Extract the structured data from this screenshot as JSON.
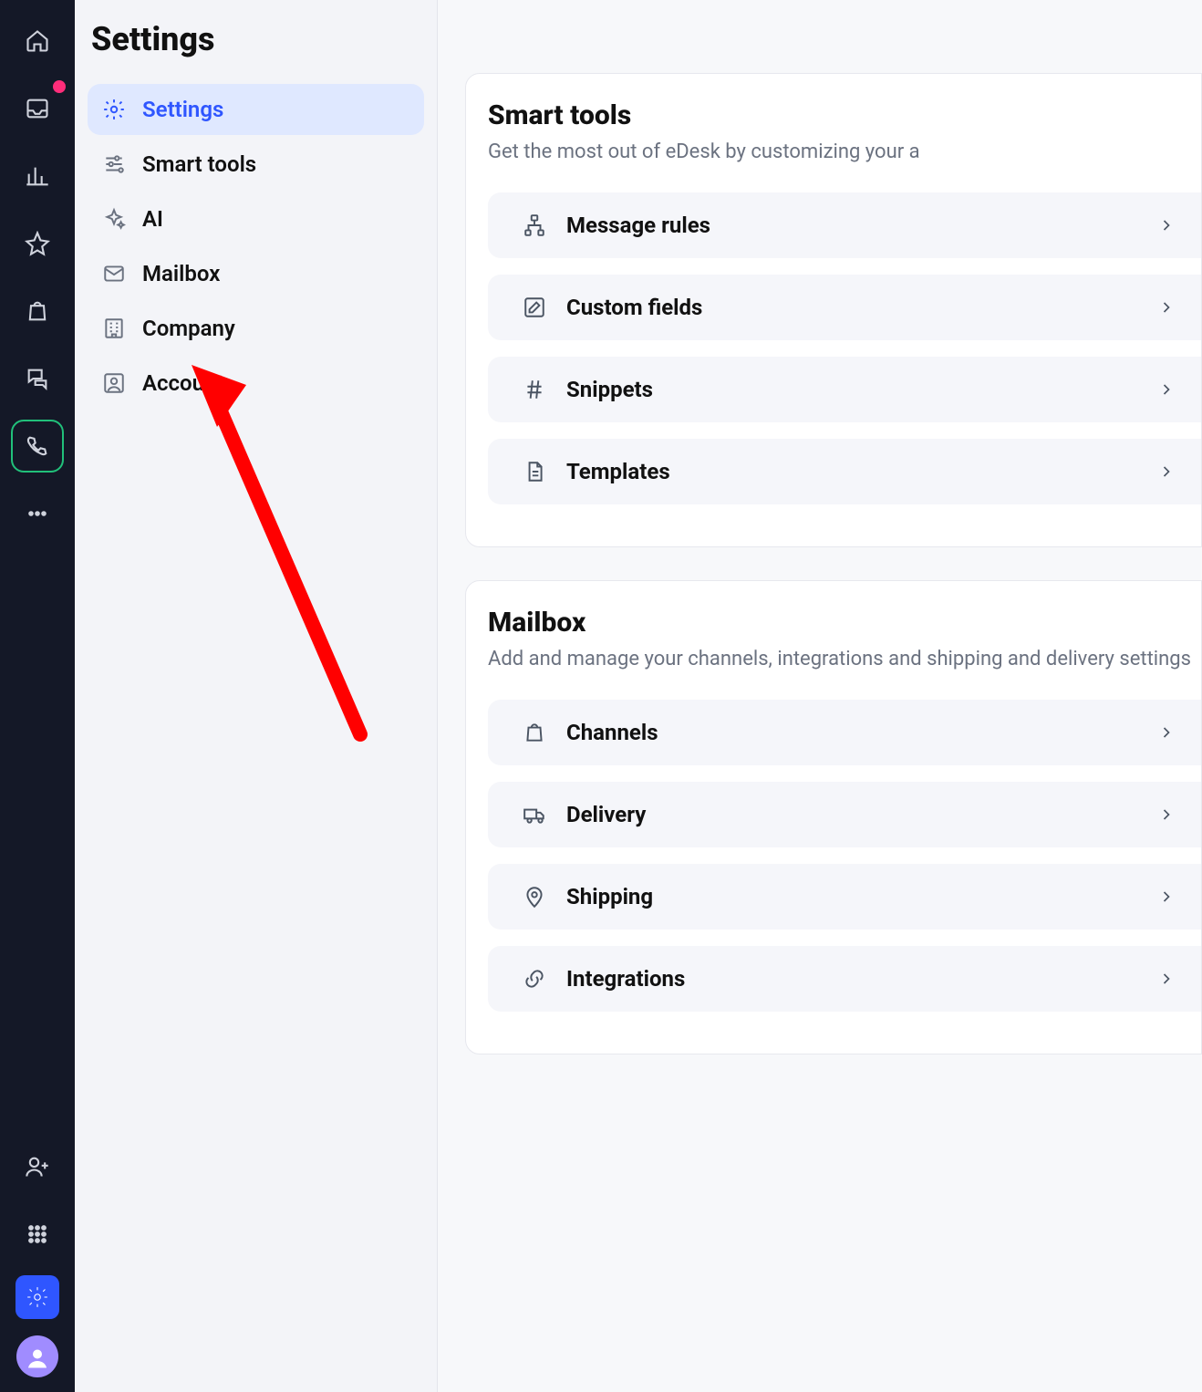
{
  "page_title": "Settings",
  "sidebar": {
    "items": [
      {
        "label": "Settings",
        "active": true
      },
      {
        "label": "Smart tools"
      },
      {
        "label": "AI"
      },
      {
        "label": "Mailbox"
      },
      {
        "label": "Company"
      },
      {
        "label": "Account"
      }
    ]
  },
  "sections": [
    {
      "title": "Smart tools",
      "subtitle": "Get the most out of eDesk by customizing your a",
      "rows": [
        {
          "label": "Message rules"
        },
        {
          "label": "Custom fields"
        },
        {
          "label": "Snippets"
        },
        {
          "label": "Templates"
        }
      ]
    },
    {
      "title": "Mailbox",
      "subtitle": "Add and manage your channels, integrations and shipping and delivery settings",
      "rows": [
        {
          "label": "Channels"
        },
        {
          "label": "Delivery"
        },
        {
          "label": "Shipping"
        },
        {
          "label": "Integrations"
        }
      ]
    }
  ]
}
